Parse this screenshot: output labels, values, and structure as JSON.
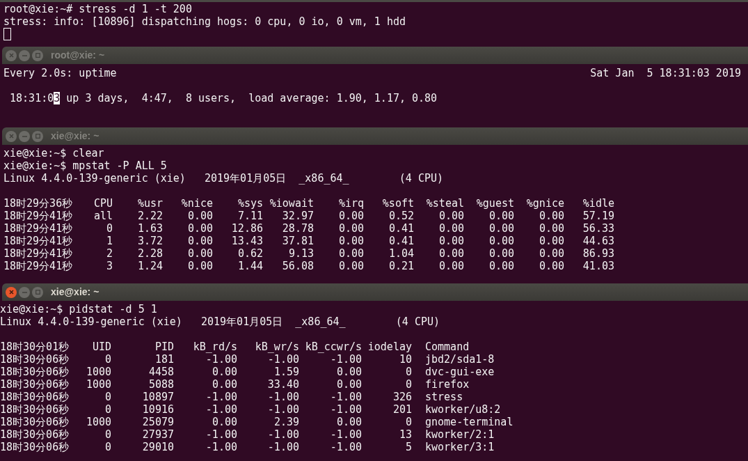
{
  "windows": [
    {
      "kind": "shell",
      "lines": [
        "root@xie:~# stress -d 1 -t 200",
        "stress: info: [10896] dispatching hogs: 0 cpu, 0 io, 0 vm, 1 hdd"
      ],
      "cursor": true
    },
    {
      "kind": "watch",
      "title": "root@xie: ~",
      "active": false,
      "header_left": "Every 2.0s: uptime",
      "header_right": "Sat Jan  5 18:31:03 2019",
      "output": {
        "before": " 18:31:0",
        "cursor_char": "3",
        "after": " up 3 days,  4:47,  8 users,  load average: 1.90, 1.17, 0.80"
      }
    },
    {
      "kind": "mpstat",
      "title": "xie@xie: ~",
      "active": false,
      "lines": [
        "xie@xie:~$ clear",
        "xie@xie:~$ mpstat -P ALL 5",
        "Linux 4.4.0-139-generic (xie)   2019年01月05日  _x86_64_        (4 CPU)"
      ],
      "table": {
        "columns": [
          "18时29分36秒",
          "CPU",
          "%usr",
          "%nice",
          "%sys",
          "%iowait",
          "%irq",
          "%soft",
          "%steal",
          "%guest",
          "%gnice",
          "%idle"
        ],
        "rows": [
          [
            "18时29分41秒",
            "all",
            "2.22",
            "0.00",
            "7.11",
            "32.97",
            "0.00",
            "0.52",
            "0.00",
            "0.00",
            "0.00",
            "57.19"
          ],
          [
            "18时29分41秒",
            "0",
            "1.63",
            "0.00",
            "12.86",
            "28.78",
            "0.00",
            "0.41",
            "0.00",
            "0.00",
            "0.00",
            "56.33"
          ],
          [
            "18时29分41秒",
            "1",
            "3.72",
            "0.00",
            "13.43",
            "37.81",
            "0.00",
            "0.41",
            "0.00",
            "0.00",
            "0.00",
            "44.63"
          ],
          [
            "18时29分41秒",
            "2",
            "2.28",
            "0.00",
            "0.62",
            "9.13",
            "0.00",
            "1.04",
            "0.00",
            "0.00",
            "0.00",
            "86.93"
          ],
          [
            "18时29分41秒",
            "3",
            "1.24",
            "0.00",
            "1.44",
            "56.08",
            "0.00",
            "0.21",
            "0.00",
            "0.00",
            "0.00",
            "41.03"
          ]
        ]
      }
    },
    {
      "kind": "pidstat",
      "title": "xie@xie: ~",
      "active": true,
      "lines": [
        "xie@xie:~$ pidstat -d 5 1",
        "Linux 4.4.0-139-generic (xie)   2019年01月05日  _x86_64_        (4 CPU)"
      ],
      "table": {
        "columns": [
          "18时30分01秒",
          "UID",
          "PID",
          "kB_rd/s",
          "kB_wr/s",
          "kB_ccwr/s",
          "iodelay",
          "Command"
        ],
        "rows": [
          [
            "18时30分06秒",
            "0",
            "181",
            "-1.00",
            "-1.00",
            "-1.00",
            "10",
            "jbd2/sda1-8"
          ],
          [
            "18时30分06秒",
            "1000",
            "4458",
            "0.00",
            "1.59",
            "0.00",
            "0",
            "dvc-gui-exe"
          ],
          [
            "18时30分06秒",
            "1000",
            "5088",
            "0.00",
            "33.40",
            "0.00",
            "0",
            "firefox"
          ],
          [
            "18时30分06秒",
            "0",
            "10897",
            "-1.00",
            "-1.00",
            "-1.00",
            "326",
            "stress"
          ],
          [
            "18时30分06秒",
            "0",
            "10916",
            "-1.00",
            "-1.00",
            "-1.00",
            "201",
            "kworker/u8:2"
          ],
          [
            "18时30分06秒",
            "1000",
            "25079",
            "0.00",
            "2.39",
            "0.00",
            "0",
            "gnome-terminal"
          ],
          [
            "18时30分06秒",
            "0",
            "27937",
            "-1.00",
            "-1.00",
            "-1.00",
            "13",
            "kworker/2:1"
          ],
          [
            "18时30分06秒",
            "0",
            "29010",
            "-1.00",
            "-1.00",
            "-1.00",
            "5",
            "kworker/3:1"
          ]
        ]
      }
    }
  ]
}
